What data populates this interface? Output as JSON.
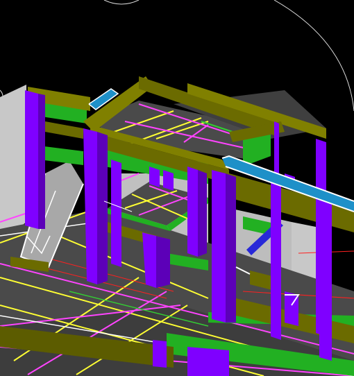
{
  "viewport": {
    "background": "#000000"
  },
  "palette": {
    "column": "#7f00ff",
    "beam_olive": "#6b6b00",
    "beam_olive_top": "#808000",
    "beam_green": "#22b022",
    "slab": "#4a4a4a",
    "wall": "#c8c8c8",
    "line_yellow": "#ffff33",
    "line_magenta": "#ff44ff",
    "line_white": "#ffffff",
    "line_red": "#ff2020",
    "pipe_cyan": "#1e90c8",
    "brace_blue": "#2828d8",
    "orbit_white": "#dddddd"
  },
  "scene": {
    "elements": [
      "left-wall",
      "floor-slab",
      "upper-slab",
      "mid-platform",
      "columns",
      "olive-beams",
      "green-beams",
      "cyan-pipe",
      "ramp",
      "grid-lines",
      "orbit-gizmo"
    ]
  }
}
